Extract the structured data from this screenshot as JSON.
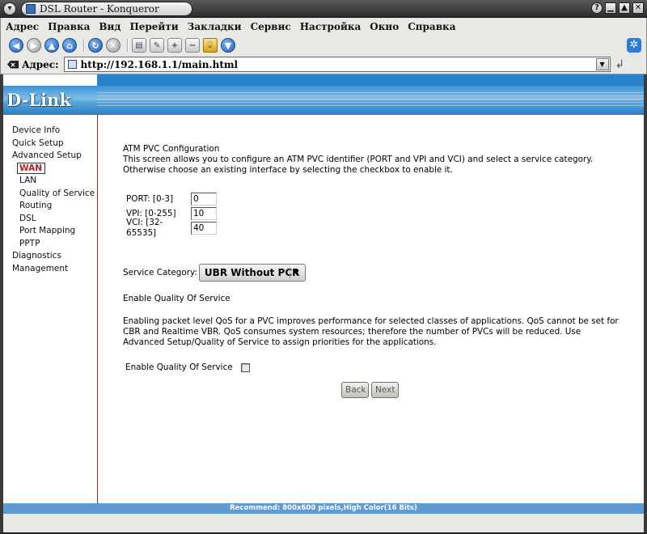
{
  "window": {
    "title": "DSL Router - Konqueror",
    "buttons": [
      "?",
      "▁",
      "▲",
      "✕"
    ]
  },
  "menubar": {
    "items": [
      "Адрес",
      "Правка",
      "Вид",
      "Перейти",
      "Закладки",
      "Сервис",
      "Настройка",
      "Окно",
      "Справка"
    ]
  },
  "location": {
    "label": "Адрес:",
    "url": "http://192.168.1.1/main.html"
  },
  "brand": {
    "logo": "D-Link"
  },
  "sidebar": {
    "items": [
      {
        "label": "Device Info"
      },
      {
        "label": "Quick Setup"
      },
      {
        "label": "Advanced Setup"
      },
      {
        "label": "WAN"
      },
      {
        "label": "LAN"
      },
      {
        "label": "Quality of Service"
      },
      {
        "label": "Routing"
      },
      {
        "label": "DSL"
      },
      {
        "label": "Port Mapping"
      },
      {
        "label": "PPTP"
      },
      {
        "label": "Diagnostics"
      },
      {
        "label": "Management"
      }
    ]
  },
  "main": {
    "title": "ATM PVC Configuration",
    "description": "This screen allows you to configure an ATM PVC identifier (PORT and VPI and VCI) and select a service category. Otherwise choose an existing interface by selecting the checkbox to enable it.",
    "fields": {
      "port": {
        "label": "PORT: [0-3]",
        "value": "0"
      },
      "vpi": {
        "label": "VPI: [0-255]",
        "value": "10"
      },
      "vci": {
        "label": "VCI: [32-65535]",
        "value": "40"
      }
    },
    "service_category": {
      "label": "Service Category:",
      "selected": "UBR Without PCR"
    },
    "qos": {
      "title": "Enable Quality Of Service",
      "description": "Enabling packet level QoS for a PVC improves performance for selected classes of applications.  QoS cannot be set for CBR and Realtime VBR.  QoS consumes system resources; therefore the number of PVCs will be reduced. Use Advanced Setup/Quality of Service to assign priorities for the applications.",
      "checkbox_label": "Enable Quality Of Service",
      "checked": false
    },
    "buttons": {
      "back": "Back",
      "next": "Next"
    }
  },
  "footer": {
    "text": "Recommend: 800x600 pixels,High Color(16 Bits)"
  },
  "colors": {
    "accent": "#2a82c8",
    "active_nav": "#b22222",
    "footer": "#5f9ad2"
  }
}
